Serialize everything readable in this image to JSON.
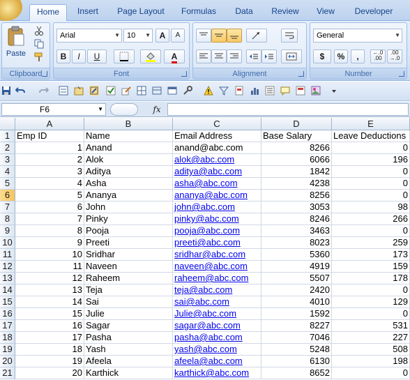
{
  "ribbon": {
    "tabs": [
      "Home",
      "Insert",
      "Page Layout",
      "Formulas",
      "Data",
      "Review",
      "View",
      "Developer"
    ],
    "active_tab": "Home",
    "clipboard": {
      "paste_label": "Paste",
      "group_label": "Clipboard"
    },
    "font": {
      "name": "Arial",
      "size": "10",
      "bold": "B",
      "italic": "I",
      "underline": "U",
      "grow": "A",
      "shrink": "A",
      "font_color_glyph": "A",
      "group_label": "Font"
    },
    "alignment": {
      "group_label": "Alignment"
    },
    "number": {
      "format": "General",
      "currency": "$",
      "percent": "%",
      "comma": ",",
      "inc_decimal": "←.0\n.00",
      "dec_decimal": ".00\n→.0",
      "group_label": "Number"
    }
  },
  "formula_bar": {
    "name_box": "F6",
    "fx_glyph": "fx",
    "content": ""
  },
  "sheet": {
    "columns": [
      "A",
      "B",
      "C",
      "D",
      "E"
    ],
    "row_numbers": [
      "1",
      "2",
      "3",
      "4",
      "5",
      "6",
      "7",
      "8",
      "9",
      "10",
      "11",
      "12",
      "13",
      "14",
      "15",
      "16",
      "17",
      "18",
      "19",
      "20",
      "21"
    ],
    "header": [
      "Emp ID",
      "Name",
      "Email Address",
      "Base Salary",
      "Leave Deductions"
    ],
    "rows": [
      [
        "1",
        "Anand",
        "anand@abc.com",
        "8266",
        "0"
      ],
      [
        "2",
        "Alok",
        "alok@abc.com",
        "6066",
        "196"
      ],
      [
        "3",
        "Aditya",
        "aditya@abc.com",
        "1842",
        "0"
      ],
      [
        "4",
        "Asha",
        "asha@abc.com",
        "4238",
        "0"
      ],
      [
        "5",
        "Ananya",
        "ananya@abc.com",
        "8256",
        "0"
      ],
      [
        "6",
        "John",
        "john@abc.com",
        "3053",
        "98"
      ],
      [
        "7",
        "Pinky",
        "pinky@abc.com",
        "8246",
        "266"
      ],
      [
        "8",
        "Pooja",
        "pooja@abc.com",
        "3463",
        "0"
      ],
      [
        "9",
        "Preeti",
        "preeti@abc.com",
        "8023",
        "259"
      ],
      [
        "10",
        "Sridhar",
        "sridhar@abc.com",
        "5360",
        "173"
      ],
      [
        "11",
        "Naveen",
        "naveen@abc.com",
        "4919",
        "159"
      ],
      [
        "12",
        "Raheem",
        "raheem@abc.com",
        "5507",
        "178"
      ],
      [
        "13",
        "Teja",
        "teja@abc.com",
        "2420",
        "0"
      ],
      [
        "14",
        "Sai",
        "sai@abc.com",
        "4010",
        "129"
      ],
      [
        "15",
        "Julie",
        "Julie@abc.com",
        "1592",
        "0"
      ],
      [
        "16",
        "Sagar",
        "sagar@abc.com",
        "8227",
        "531"
      ],
      [
        "17",
        "Pasha",
        "pasha@abc.com",
        "7046",
        "227"
      ],
      [
        "18",
        "Yash",
        "yash@abc.com",
        "5248",
        "508"
      ],
      [
        "19",
        "Afeela",
        "afeela@abc.com",
        "6130",
        "198"
      ],
      [
        "20",
        "Karthick",
        "karthick@abc.com",
        "8652",
        "0"
      ]
    ],
    "hyperlinked_rows_from_index": 1,
    "selected_cell": "F6"
  },
  "colors": {
    "accent": "#15428b",
    "link": "#0000ee",
    "selection": "#f4c45e"
  }
}
